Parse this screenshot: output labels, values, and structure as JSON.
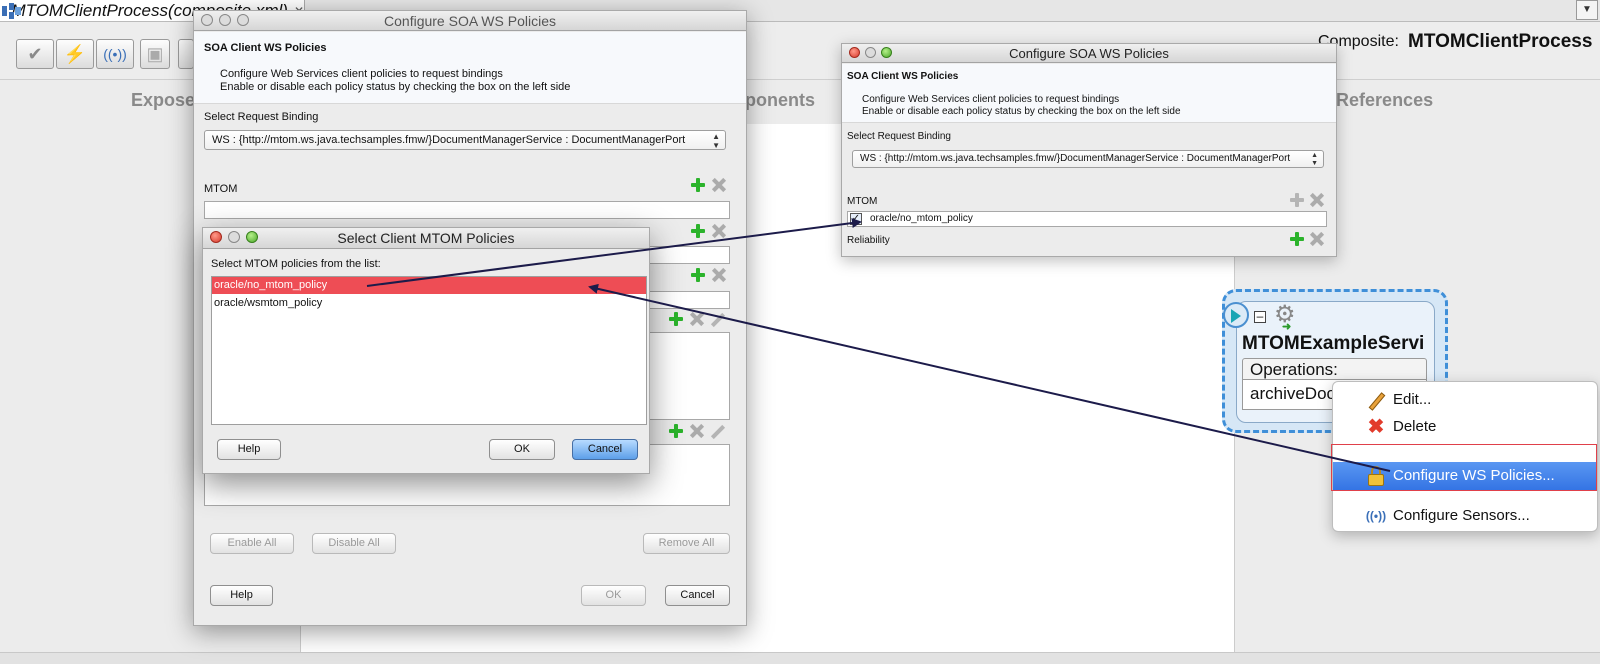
{
  "editor": {
    "tab_title": "MTOMClientProcess(composite.xml)",
    "composite_label": "Composite:",
    "composite_name": "MTOMClientProcess",
    "columns": [
      "Exposed Services",
      "Components",
      "External References"
    ]
  },
  "component": {
    "name": "MTOMExampleService",
    "operations_label": "Operations:",
    "operation": "archiveDocument"
  },
  "back_dialog": {
    "title": "Configure SOA WS Policies",
    "heading": "SOA Client WS Policies",
    "desc_line1": "Configure Web Services client policies to request bindings",
    "desc_line2": "Enable or disable each policy status by checking the box on the left side",
    "binding_label": "Select Request Binding",
    "binding_value": "WS : {http://mtom.ws.java.techsamples.fmw/}DocumentManagerService : DocumentManagerPort",
    "mtom_label": "MTOM",
    "enable_all": "Enable All",
    "disable_all": "Disable All",
    "remove_all": "Remove All",
    "help": "Help",
    "ok": "OK",
    "cancel": "Cancel"
  },
  "select_dialog": {
    "title": "Select Client MTOM Policies",
    "prompt": "Select MTOM policies from the list:",
    "items": [
      "oracle/no_mtom_policy",
      "oracle/wsmtom_policy"
    ],
    "help": "Help",
    "ok": "OK",
    "cancel": "Cancel"
  },
  "result_dialog": {
    "title": "Configure SOA WS Policies",
    "heading": "SOA Client WS Policies",
    "desc_line1": "Configure Web Services client policies to request bindings",
    "desc_line2": "Enable or disable each policy status by checking the box on the left side",
    "binding_label": "Select Request Binding",
    "binding_value": "WS : {http://mtom.ws.java.techsamples.fmw/}DocumentManagerService : DocumentManagerPort",
    "mtom_label": "MTOM",
    "mtom_policy": "oracle/no_mtom_policy",
    "reliability_label": "Reliability"
  },
  "context_menu": {
    "items": [
      {
        "label": "Edit...",
        "icon": "pencil-icon"
      },
      {
        "label": "Delete",
        "icon": "delete-x-icon"
      },
      {
        "label": "Configure WS Policies...",
        "icon": "lock-icon"
      },
      {
        "label": "Configure Sensors...",
        "icon": "sensor-icon"
      }
    ]
  },
  "colors": {
    "selection_red": "#ee4d55",
    "menu_highlight": "#3b7be8",
    "annotation_arrow": "#1c1b4a",
    "annotation_box": "#e0404a",
    "component_border": "#3f8fd8"
  }
}
